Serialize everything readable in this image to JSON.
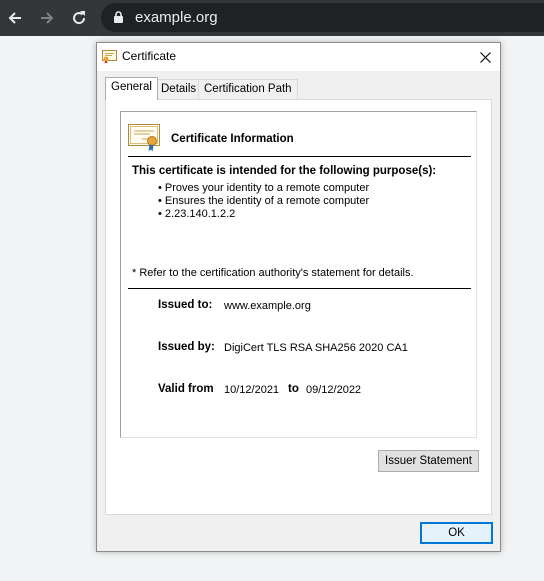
{
  "browser": {
    "url": "example.org"
  },
  "dialog": {
    "title": "Certificate",
    "tabs": [
      {
        "label": "General",
        "active": true
      },
      {
        "label": "Details",
        "active": false
      },
      {
        "label": "Certification Path",
        "active": false
      }
    ],
    "info": {
      "title": "Certificate Information",
      "purpose_heading": "This certificate is intended for the following purpose(s):",
      "purposes": [
        "Proves your identity to a remote computer",
        "Ensures the identity of a remote computer",
        "2.23.140.1.2.2"
      ],
      "footnote": "* Refer to the certification authority's statement for details.",
      "issued_to_label": "Issued to:",
      "issued_to_value": "www.example.org",
      "issued_by_label": "Issued by:",
      "issued_by_value": "DigiCert TLS RSA SHA256 2020 CA1",
      "valid_from_label": "Valid from",
      "valid_from_value": "10/12/2021",
      "valid_to_label": "to",
      "valid_to_value": "09/12/2022"
    },
    "issuer_statement_button": "Issuer Statement",
    "ok_button": "OK"
  },
  "colors": {
    "toolbar": "#35363a",
    "omnibox": "#202124",
    "accent": "#0078d7"
  }
}
